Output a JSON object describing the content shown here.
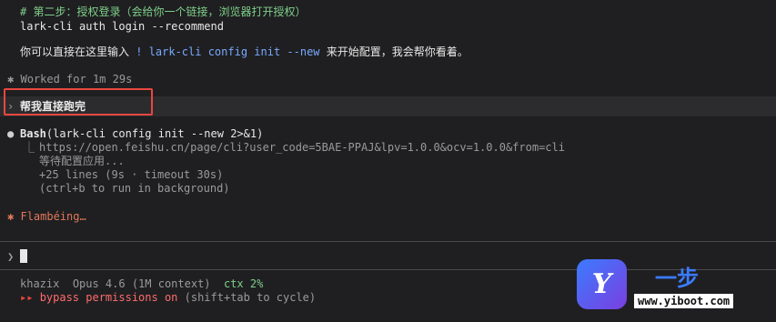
{
  "terminal": {
    "step2_comment": "# 第二步：授权登录（会给你一个链接，浏览器打开授权）",
    "step2_cmd": "lark-cli auth login --recommend",
    "hint_prefix": "你可以直接在这里输入 ",
    "hint_cmd": "! lark-cli config init --new",
    "hint_suffix": " 来开始配置，我会帮你看着。",
    "worked_marker": "✱",
    "worked": "Worked for 1m 29s",
    "user_arrow": "›",
    "user_message": "帮我直接跑完",
    "bash_bullet": "●",
    "bash_label": "Bash",
    "bash_args": "(lark-cli config init --new 2>&1)",
    "tree_glyph": "⎿",
    "out_url": "https://open.feishu.cn/page/cli?user_code=5BAE-PPAJ&lpv=1.0.0&ocv=1.0.0&from=cli",
    "out_wait": "等待配置应用...",
    "out_lines": "+25 lines (9s · timeout 30s)",
    "out_bg": "(ctrl+b to run in background)",
    "status_marker": "✱",
    "status": "Flambéing…",
    "prompt_arrow": "❯",
    "footer_user": "khazix",
    "footer_model": "Opus 4.6 (1M context)",
    "footer_ctx": "ctx 2%",
    "bypass_arrows": "▸▸",
    "bypass": "bypass permissions on",
    "bypass_hint": " (shift+tab to cycle)"
  },
  "watermark": {
    "logo_letter": "Y",
    "title": "一步",
    "url": "www.yiboot.com"
  },
  "colors": {
    "background": "#1f1f21",
    "comment_green": "#7fcf8a",
    "command_blue": "#78a9ff",
    "status_orange": "#e0785a",
    "highlight_red": "#e8473f"
  }
}
